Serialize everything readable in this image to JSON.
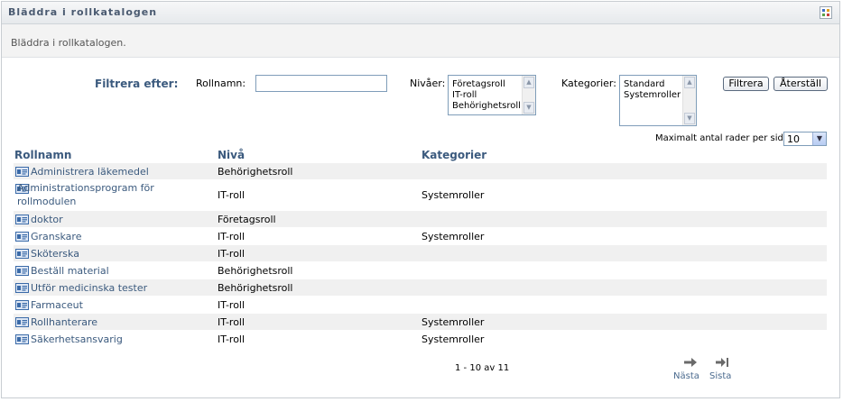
{
  "panel": {
    "title": "Bläddra i rollkatalogen",
    "description": "Bläddra i rollkatalogen."
  },
  "filter": {
    "heading": "Filtrera efter:",
    "role_name_label": "Rollnamn:",
    "role_name_value": "",
    "levels_label": "Nivåer:",
    "levels_options": [
      "Företagsroll",
      "IT-roll",
      "Behörighetsroll"
    ],
    "categories_label": "Kategorier:",
    "categories_options": [
      "Standard",
      "Systemroller"
    ],
    "filter_button": "Filtrera",
    "reset_button": "Återställ"
  },
  "max_rows": {
    "label": "Maximalt antal rader per sida",
    "value": "10"
  },
  "table": {
    "headers": {
      "name": "Rollnamn",
      "level": "Nivå",
      "categories": "Kategorier"
    },
    "rows": [
      {
        "name": "Administrera läkemedel",
        "level": "Behörighetsroll",
        "categories": ""
      },
      {
        "name": "Administrationsprogram för rollmodulen",
        "name_line1": "Administrationsprogram för",
        "name_line2": "rollmodulen",
        "level": "IT-roll",
        "categories": "Systemroller"
      },
      {
        "name": "doktor",
        "level": "Företagsroll",
        "categories": ""
      },
      {
        "name": "Granskare",
        "level": "IT-roll",
        "categories": "Systemroller"
      },
      {
        "name": "Sköterska",
        "level": "IT-roll",
        "categories": ""
      },
      {
        "name": "Beställ material",
        "level": "Behörighetsroll",
        "categories": ""
      },
      {
        "name": "Utför medicinska tester",
        "level": "Behörighetsroll",
        "categories": ""
      },
      {
        "name": "Farmaceut",
        "level": "IT-roll",
        "categories": ""
      },
      {
        "name": "Rollhanterare",
        "level": "IT-roll",
        "categories": "Systemroller"
      },
      {
        "name": "Säkerhetsansvarig",
        "level": "IT-roll",
        "categories": "Systemroller"
      }
    ]
  },
  "pager": {
    "info": "1 - 10 av 11",
    "next": "Nästa",
    "last": "Sista"
  },
  "colors": {
    "link": "#3b5a7e",
    "row_alt": "#f0f0f0",
    "border": "#c8cdd2"
  }
}
